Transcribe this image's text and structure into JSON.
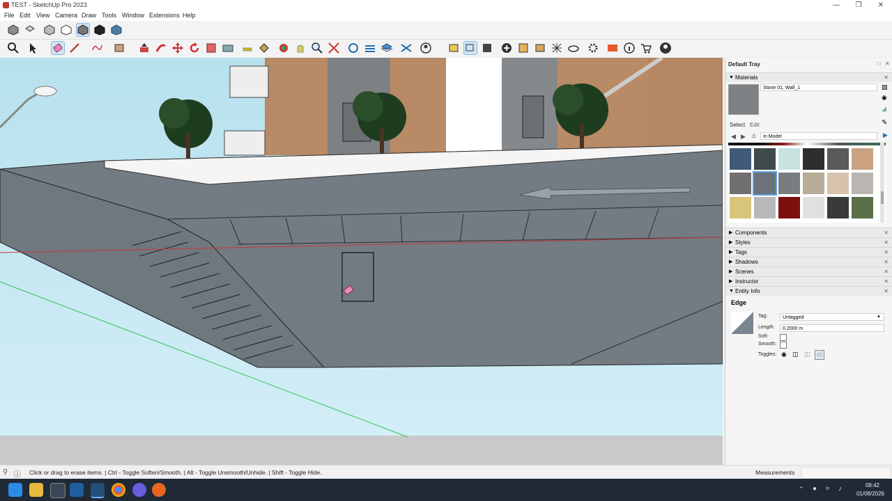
{
  "window": {
    "title": "TEST - SketchUp Pro 2023"
  },
  "menu": [
    "File",
    "Edit",
    "View",
    "Camera",
    "Draw",
    "Tools",
    "Window",
    "Extensions",
    "Help"
  ],
  "tray": {
    "title": "Default Tray",
    "materials": {
      "header": "Materials",
      "material_name": "Stone 01, Wall_1",
      "tab_select": "Select",
      "tab_edit": "Edit",
      "collection": "In Model",
      "swatch_colors": [
        "#415a78",
        "#3f4a4a",
        "#c8e2df",
        "#2e2e2e",
        "#5a5a5a",
        "#c9a283",
        "#707070",
        "#6c727a",
        "#7a7d80",
        "#b8ab98",
        "#d8c2ad",
        "#b9b6b1",
        "#d8c57a",
        "#b8b8b8",
        "#7f0f0f",
        "#e0e0e0",
        "#3a3a3a",
        "#5b6e4a"
      ]
    },
    "sections": [
      "Components",
      "Styles",
      "Tags",
      "Shadows",
      "Scenes",
      "Instructor"
    ],
    "entity_info": {
      "header": "Entity Info",
      "type": "Edge",
      "tag_label": "Tag:",
      "tag_value": "Untagged",
      "length_label": "Length:",
      "length_value": "0.2000 m",
      "soft_label": "Soft:",
      "smooth_label": "Smooth:",
      "toggles_label": "Toggles:"
    }
  },
  "status": {
    "hint": "Click or drag to erase items. | Ctrl - Toggle Soften/Smooth. | Alt - Toggle Unsmooth/Unhide. | Shift - Toggle Hide.",
    "measurements_label": "Measurements"
  },
  "taskbar": {
    "time": "08:42",
    "date": "01/08/2026"
  }
}
